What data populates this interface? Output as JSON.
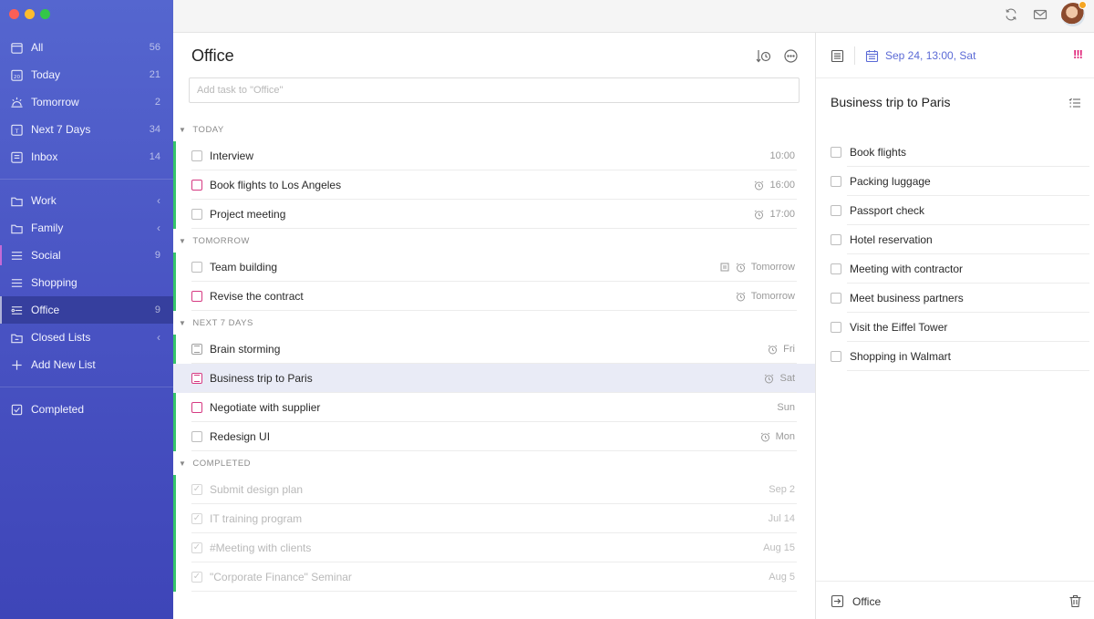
{
  "sidebar": {
    "smart_lists": [
      {
        "label": "All",
        "count": "56",
        "icon": "all-icon"
      },
      {
        "label": "Today",
        "count": "21",
        "icon": "calendar-today-icon"
      },
      {
        "label": "Tomorrow",
        "count": "2",
        "icon": "sunrise-icon"
      },
      {
        "label": "Next 7 Days",
        "count": "34",
        "icon": "calendar-week-icon"
      },
      {
        "label": "Inbox",
        "count": "14",
        "icon": "inbox-icon"
      }
    ],
    "folders": [
      {
        "label": "Work",
        "icon": "folder-icon"
      },
      {
        "label": "Family",
        "icon": "folder-icon"
      }
    ],
    "lists": [
      {
        "label": "Social",
        "count": "9"
      },
      {
        "label": "Shopping",
        "count": ""
      },
      {
        "label": "Office",
        "count": "9"
      }
    ],
    "closed_lists": "Closed Lists",
    "add_new_list": "Add New List",
    "completed": "Completed"
  },
  "main": {
    "title": "Office",
    "add_placeholder": "Add task to \"Office\"",
    "sections": [
      {
        "header": "TODAY",
        "tasks": [
          {
            "title": "Interview",
            "time": "10:00"
          },
          {
            "title": "Book flights to Los Angeles",
            "time": "16:00"
          },
          {
            "title": "Project meeting",
            "time": "17:00"
          }
        ]
      },
      {
        "header": "TOMORROW",
        "tasks": [
          {
            "title": "Team building",
            "time": "Tomorrow"
          },
          {
            "title": "Revise the contract",
            "time": "Tomorrow"
          }
        ]
      },
      {
        "header": "NEXT 7 DAYS",
        "tasks": [
          {
            "title": "Brain storming",
            "time": "Fri"
          },
          {
            "title": "Business trip to Paris",
            "time": "Sat"
          },
          {
            "title": "Negotiate with supplier",
            "time": "Sun"
          },
          {
            "title": "Redesign UI",
            "time": "Mon"
          }
        ]
      },
      {
        "header": "COMPLETED",
        "tasks": [
          {
            "title": "Submit  design plan",
            "time": "Sep 2"
          },
          {
            "title": "IT training program",
            "time": "Jul 14"
          },
          {
            "title": "#Meeting with clients",
            "time": "Aug 15"
          },
          {
            "title": "\"Corporate Finance\" Seminar",
            "time": "Aug 5"
          }
        ]
      }
    ]
  },
  "detail": {
    "due": "Sep 24, 13:00, Sat",
    "priority": "!!!",
    "title": "Business trip to Paris",
    "checklist": [
      "Book flights",
      "Packing luggage",
      "Passport check",
      "Hotel reservation",
      "Meeting with contractor",
      "Meet business partners",
      "Visit the Eiffel Tower",
      "Shopping in Walmart"
    ],
    "list_name": "Office"
  },
  "colors": {
    "accent": "#5b6ad6",
    "priority_high": "#e0267a",
    "today_group_bar": "#35c56a",
    "sidebar_top": "#5566cf",
    "sidebar_bottom": "#3e45b8"
  }
}
